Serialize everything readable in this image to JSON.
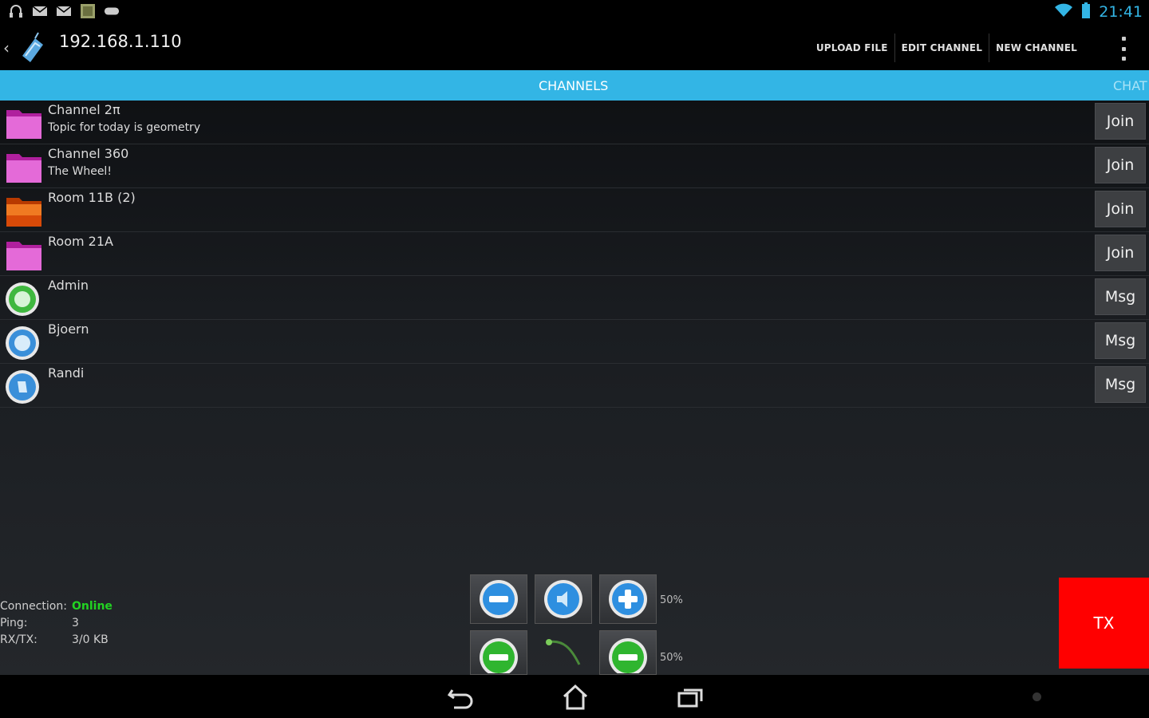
{
  "status_bar": {
    "left_icons": [
      "headphones-icon",
      "email-icon",
      "email-icon",
      "image-icon",
      "gamepad-icon"
    ],
    "right_icons": [
      "wifi-icon",
      "battery-icon"
    ],
    "time": "21:41"
  },
  "action_bar": {
    "title": "192.168.1.110",
    "actions": [
      "UPLOAD FILE",
      "EDIT CHANNEL",
      "NEW CHANNEL"
    ]
  },
  "tabs": [
    "CHANNELS",
    "CHAT"
  ],
  "channels": [
    {
      "title": "Channel 2π",
      "subtitle": "Topic for today is geometry",
      "icon": "folder-icon",
      "button": "Join",
      "color": "#e040d0"
    },
    {
      "title": "Channel 360",
      "subtitle": "The Wheel!",
      "icon": "folder-icon",
      "button": "Join",
      "color": "#e040d0"
    },
    {
      "title": "Room 11B (2)",
      "subtitle": "",
      "icon": "folder-icon",
      "button": "Join",
      "color": "#e85a10"
    },
    {
      "title": "Room 21A",
      "subtitle": "",
      "icon": "folder-icon",
      "button": "Join",
      "color": "#e040d0"
    }
  ],
  "users": [
    {
      "name": "Admin",
      "icon": "user-green-icon",
      "button": "Msg",
      "color": "#3fb83f"
    },
    {
      "name": "Bjoern",
      "icon": "user-blue-icon",
      "button": "Msg",
      "color": "#3a8fd9"
    },
    {
      "name": "Randi",
      "icon": "user-blue-icon",
      "button": "Msg",
      "color": "#3a8fd9"
    }
  ],
  "connection": {
    "connection_label": "Connection:",
    "connection_value": "Online",
    "ping_label": "Ping:",
    "ping_value": "3",
    "rxtx_label": "RX/TX:",
    "rxtx_value": "3/0 KB"
  },
  "controls": {
    "volume_pct": "50%",
    "mic_pct": "50%"
  },
  "tx_label": "TX",
  "colors": {
    "accent": "#33b5e5",
    "online": "#22d322",
    "tx": "#ff0000"
  }
}
